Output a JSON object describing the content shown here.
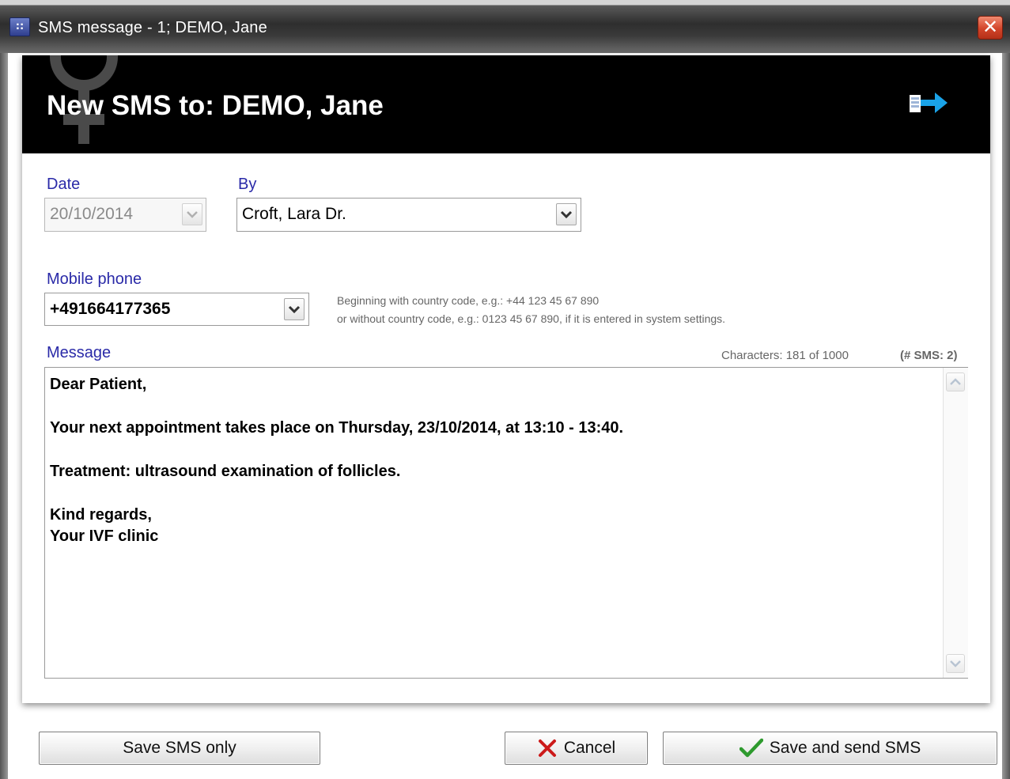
{
  "window": {
    "title": "SMS message - 1; DEMO, Jane",
    "app_icon_glyph": "∷",
    "close_glyph": "✕"
  },
  "header": {
    "heading": "New SMS to: DEMO, Jane",
    "icons": [
      "venus-symbol-icon",
      "forward-arrow-icon"
    ]
  },
  "form": {
    "date_label": "Date",
    "date_value": "20/10/2014",
    "by_label": "By",
    "by_value": "Croft, Lara Dr.",
    "mobile_label": "Mobile phone",
    "mobile_value": "+491664177365",
    "hint_line1": "Beginning with country code, e.g.: +44 123 45 67 890",
    "hint_line2": "or without country code, e.g.: 0123 45 67 890, if it is entered in system settings.",
    "message_label": "Message",
    "characters": "Characters: 181 of 1000",
    "sms_count": "(# SMS: 2)"
  },
  "message": {
    "lines": [
      "Dear Patient,",
      "Your next appointment takes place on Thursday, 23/10/2014, at 13:10 - 13:40.",
      "Treatment: ultrasound examination of follicles.",
      "Kind regards,",
      "Your IVF clinic"
    ]
  },
  "buttons": {
    "save_only": "Save SMS only",
    "cancel": "Cancel",
    "save_send": "Save and send SMS"
  },
  "colors": {
    "label_blue": "#2a2aa8",
    "header_bg": "#000000",
    "close_red": "#d2452a",
    "cancel_x_red": "#cc1a1a",
    "check_green": "#2e9a2e",
    "arrow_blue": "#1aa3e8"
  }
}
